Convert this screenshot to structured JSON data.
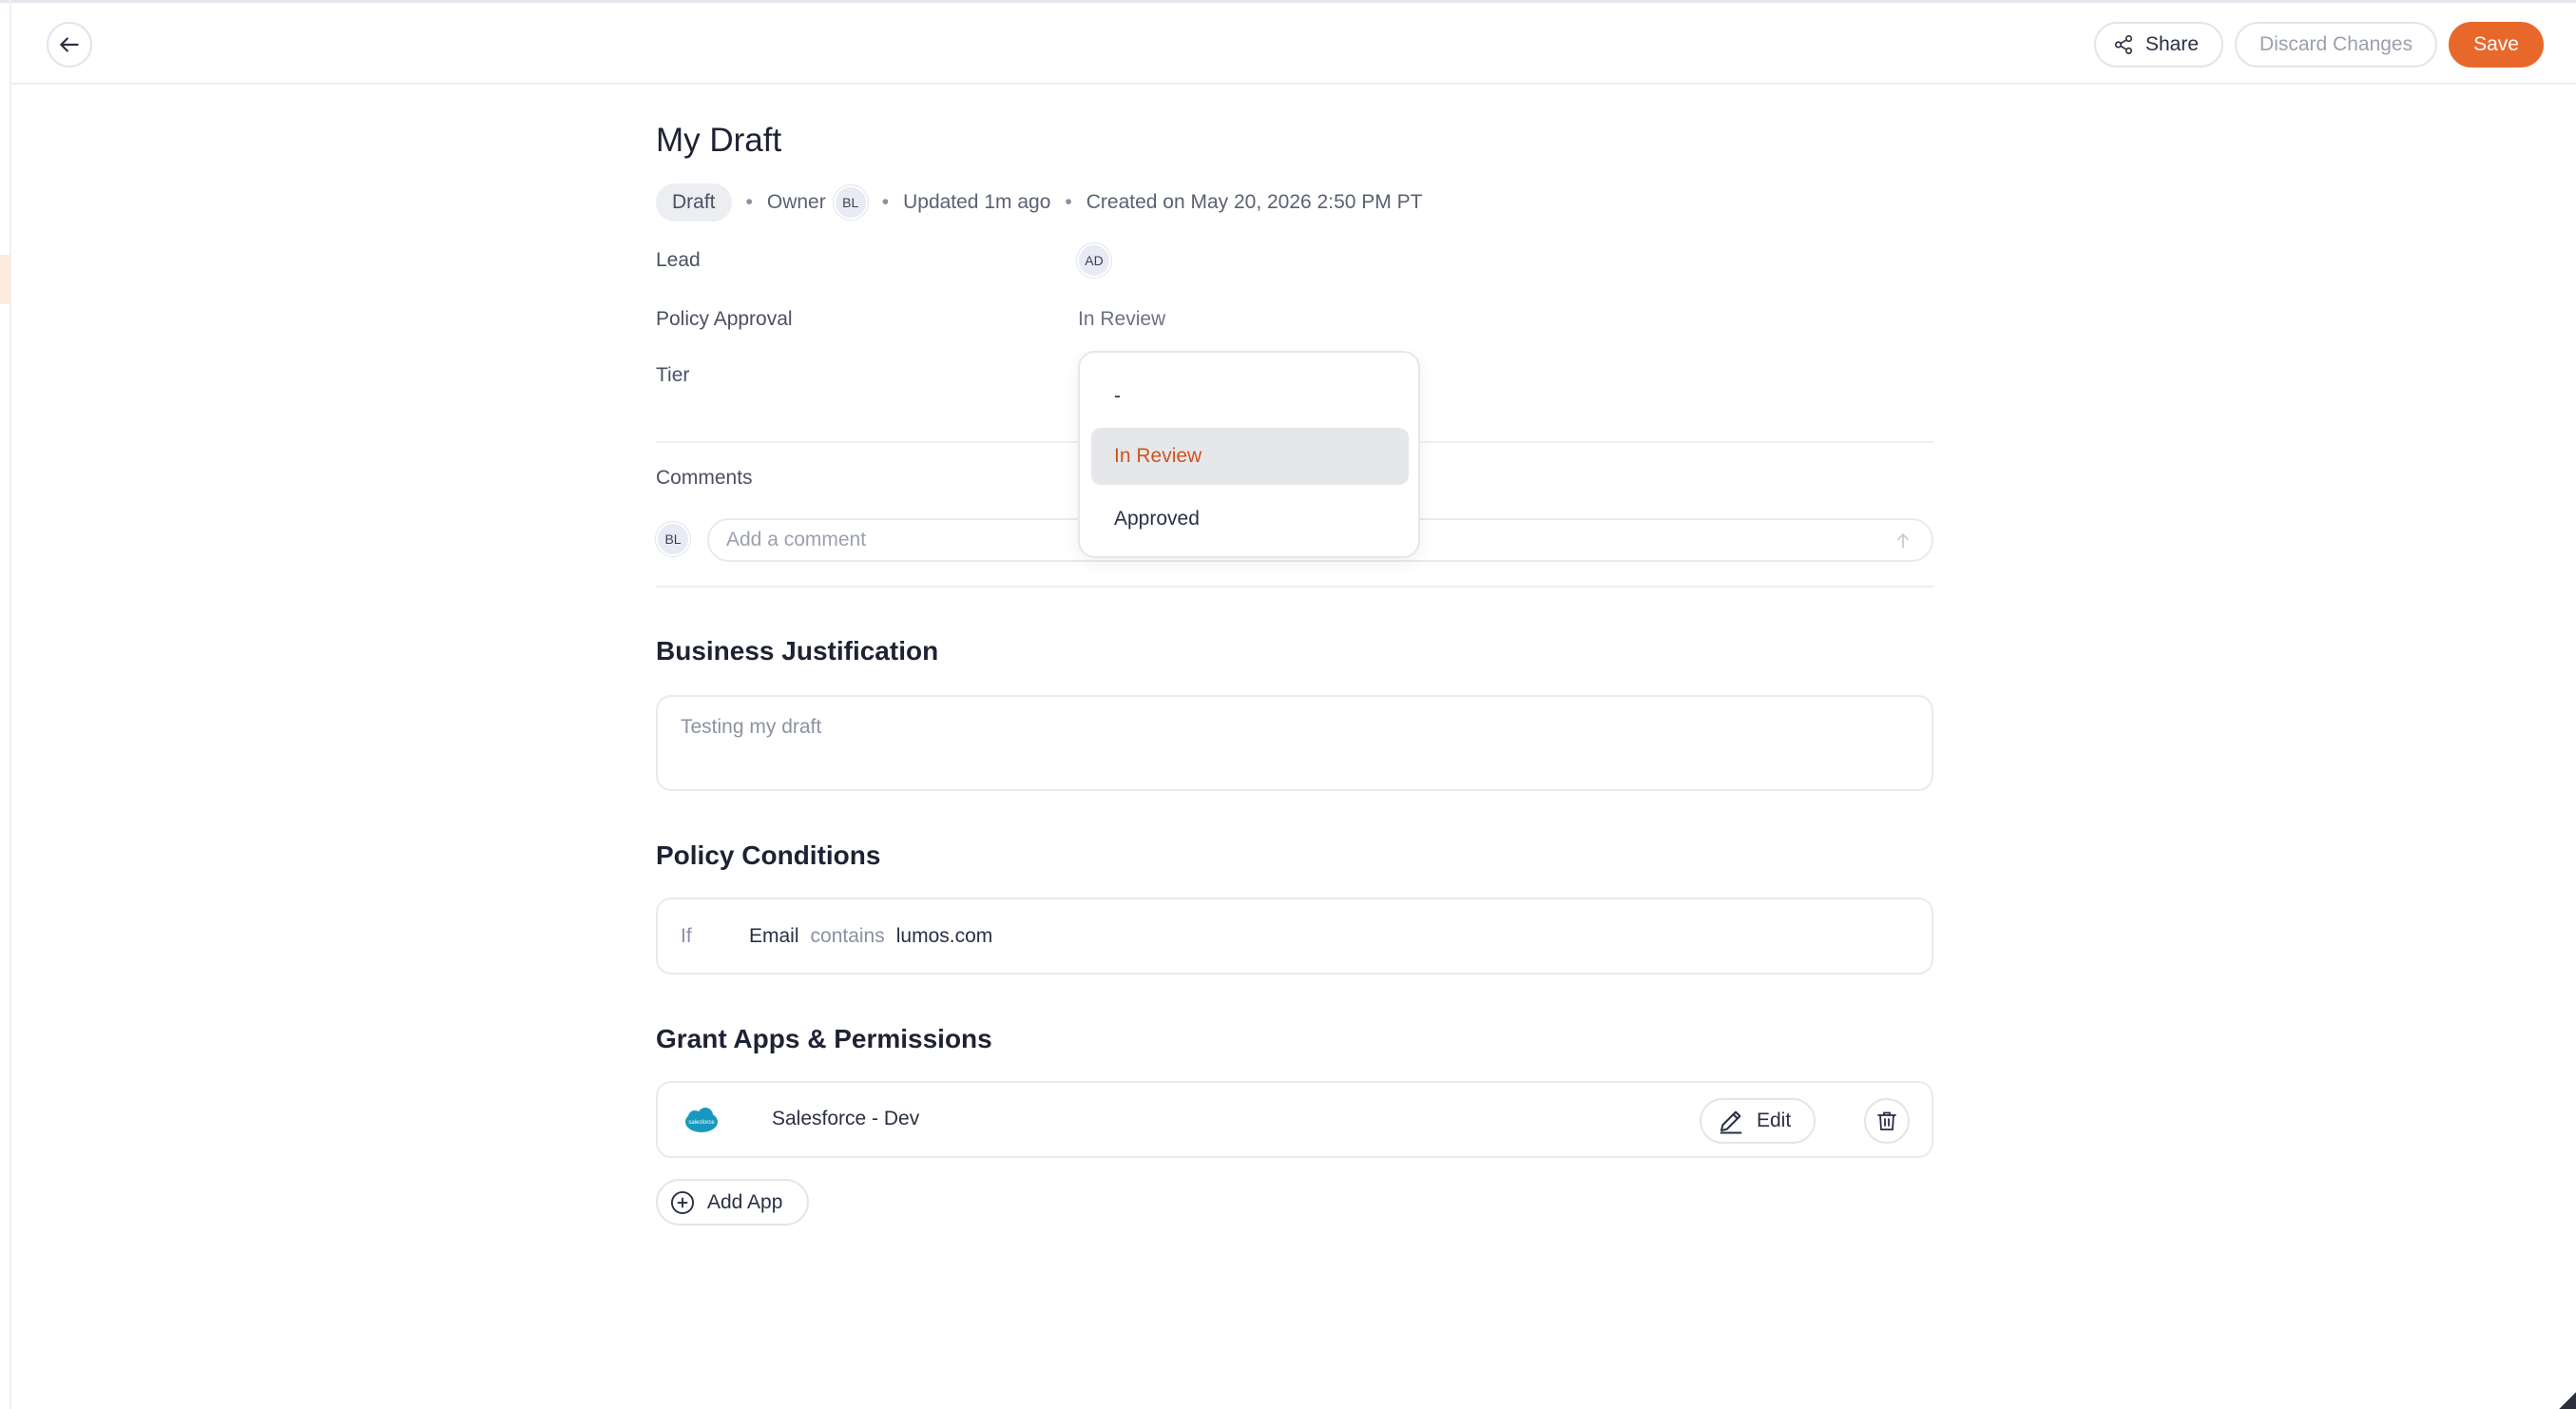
{
  "header": {
    "share_label": "Share",
    "discard_label": "Discard Changes",
    "save_label": "Save"
  },
  "page": {
    "title": "My Draft",
    "status_badge": "Draft",
    "owner_label": "Owner",
    "owner_initials": "BL",
    "updated": "Updated 1m ago",
    "created": "Created on May 20, 2026 2:50 PM PT"
  },
  "fields": {
    "lead_label": "Lead",
    "lead_initials": "AD",
    "policy_approval_label": "Policy Approval",
    "policy_approval_value": "In Review",
    "tier_label": "Tier"
  },
  "dropdown": {
    "options": [
      "-",
      "In Review",
      "Approved"
    ],
    "selected": "In Review"
  },
  "comments": {
    "label": "Comments",
    "user_initials": "BL",
    "placeholder": "Add a comment"
  },
  "business_justification": {
    "title": "Business Justification",
    "value": "Testing my draft"
  },
  "policy_conditions": {
    "title": "Policy Conditions",
    "if_label": "If",
    "field": "Email",
    "operator": "contains",
    "value": "lumos.com"
  },
  "grant_apps": {
    "title": "Grant Apps & Permissions",
    "apps": [
      {
        "name": "Salesforce - Dev",
        "logo_text": "salesforce"
      }
    ],
    "edit_label": "Edit",
    "add_app_label": "Add App"
  },
  "colors": {
    "accent": "#e8682c",
    "selected_text": "#d0531e"
  },
  "icons": [
    "back-arrow-icon",
    "share-icon",
    "send-arrow-icon",
    "salesforce-logo",
    "pencil-icon",
    "trash-icon",
    "plus-circle-icon"
  ]
}
